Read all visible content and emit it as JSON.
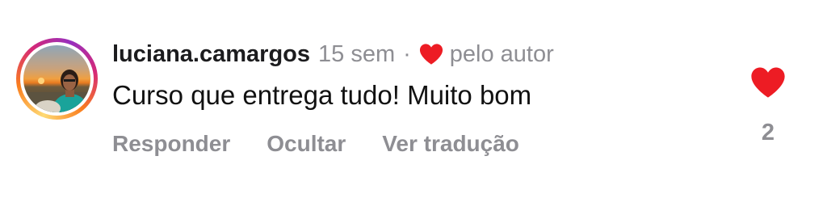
{
  "comment": {
    "username": "luciana.camargos",
    "time_ago": "15 sem",
    "separator": "·",
    "author_like_label": "pelo autor",
    "text": "Curso que entrega tudo! Muito bom",
    "actions": {
      "reply": "Responder",
      "hide": "Ocultar",
      "translate": "Ver tradução"
    },
    "like_count": "2",
    "liked": true,
    "icons": {
      "author_heart": "heart-icon",
      "like": "heart-icon",
      "avatar": "profile-photo"
    },
    "colors": {
      "heart": "#ed1c24",
      "muted_text": "#8e8e93",
      "primary_text": "#111111",
      "story_ring": [
        "#feda75",
        "#fa7e1e",
        "#d62976",
        "#962fbf"
      ]
    }
  }
}
